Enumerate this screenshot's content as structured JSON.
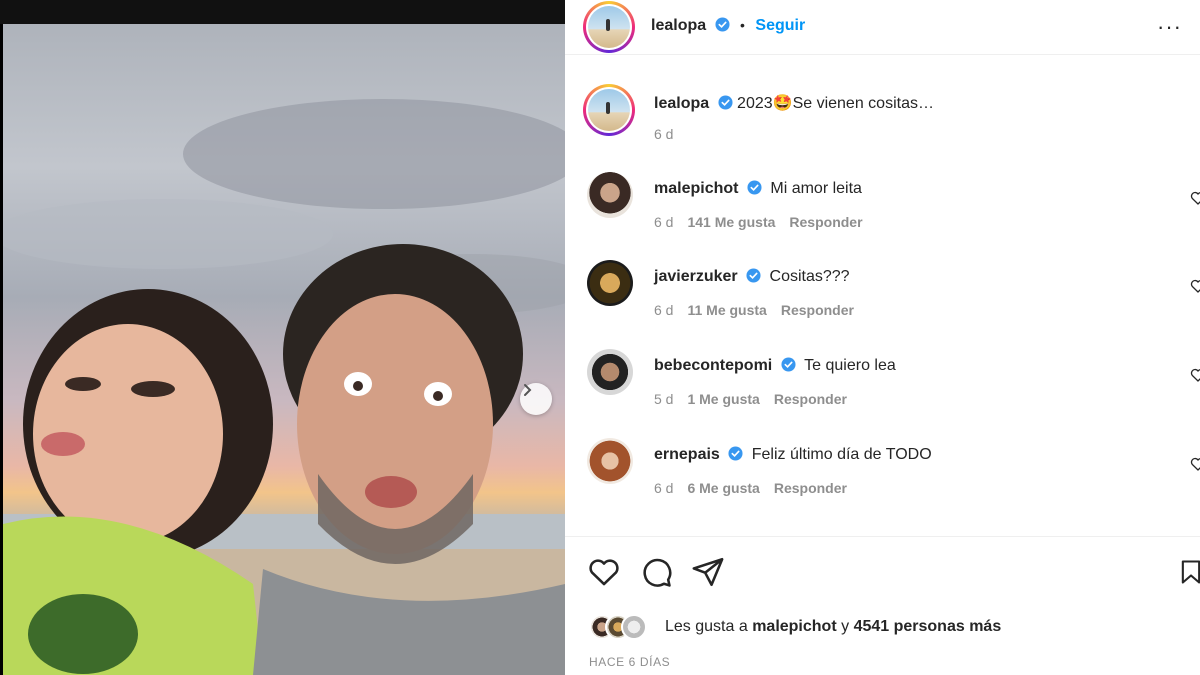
{
  "post": {
    "author": "lealopa",
    "follow_label": "Seguir",
    "separator": "•",
    "more_label": "···",
    "caption": "2023🤩Se vienen cositas…",
    "caption_time": "6 d"
  },
  "comments": [
    {
      "user": "malepichot",
      "text": "Mi amor leita",
      "time": "6 d",
      "likes": "141 Me gusta",
      "reply": "Responder"
    },
    {
      "user": "javierzuker",
      "text": "Cositas???",
      "time": "6 d",
      "likes": "11 Me gusta",
      "reply": "Responder"
    },
    {
      "user": "bebecontepomi",
      "text": "Te quiero lea",
      "time": "5 d",
      "likes": "1 Me gusta",
      "reply": "Responder"
    },
    {
      "user": "ernepais",
      "text": "Feliz último día de TODO",
      "time": "6 d",
      "likes": "6 Me gusta",
      "reply": "Responder"
    }
  ],
  "likes_summary": {
    "prefix": "Les gusta a",
    "first_user": "malepichot",
    "conjunction": "y",
    "others": "4541 personas más"
  },
  "date_label": "HACE 6 DÍAS",
  "icons": [
    "heart-icon",
    "comment-icon",
    "share-icon",
    "bookmark-icon",
    "verified-icon",
    "chevron-right-icon",
    "more-icon"
  ],
  "colors": {
    "accent": "#0095f6",
    "verified": "#3897f0",
    "muted": "#8e8e8e"
  }
}
